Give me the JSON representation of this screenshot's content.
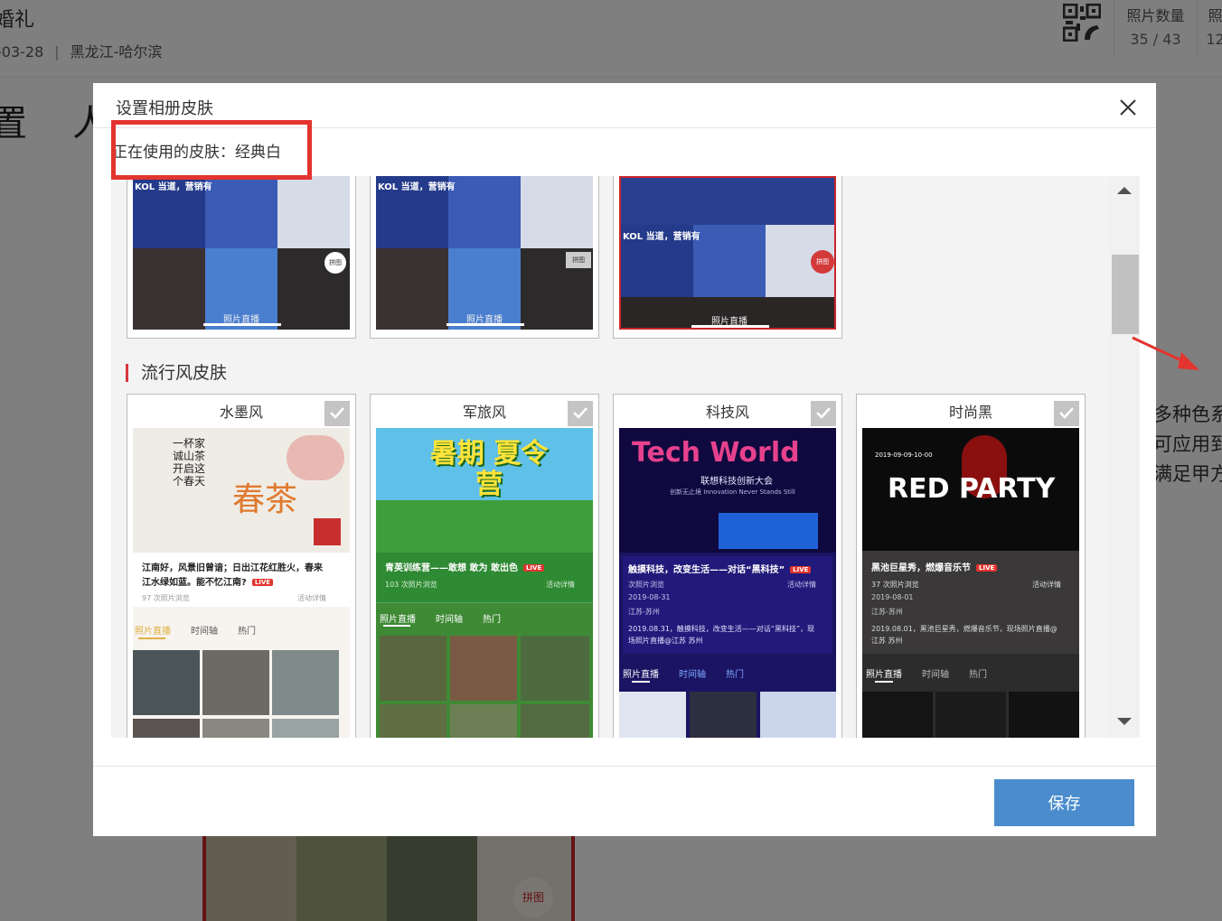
{
  "background": {
    "event_title": "婚礼",
    "event_date": "-03-28",
    "event_location": "黑龙江-哈尔滨",
    "stats": [
      {
        "label": "照片数量",
        "value": "35 / 43"
      },
      {
        "label": "照",
        "value": "12"
      }
    ],
    "left_glyphs": [
      "置",
      "人"
    ],
    "side_text": [
      "多种色系",
      "可应用到",
      "满足甲方"
    ],
    "bottom_poster_tag": "拼图"
  },
  "modal": {
    "title": "设置相册皮肤",
    "current_skin_label": "正在使用的皮肤：经典白",
    "save_label": "保存"
  },
  "classic_thumbs": [
    {
      "headline": "KOL 当道，营销有",
      "badge": "拼图",
      "footer": "照片直播"
    },
    {
      "headline": "KOL 当道，营销有",
      "badge": "拼图",
      "footer": "照片直播"
    },
    {
      "headline": "KOL 当道，营销有",
      "badge": "拼图",
      "footer": "照片直播"
    }
  ],
  "section": {
    "title": "流行风皮肤"
  },
  "skins": [
    {
      "name": "水墨风",
      "art_title": "春茶",
      "art_poem": "一杯家诚山茶开启这个春天",
      "event_line1": "江南好，风景旧曾谙；日出江花红胜火，春来",
      "event_line2": "江水绿如蓝。能不忆江南?",
      "badge": "LIVE",
      "views": "97 次照片浏览",
      "detail": "活动详情",
      "tabs": [
        "照片直播",
        "时间轴",
        "热门"
      ]
    },
    {
      "name": "军旅风",
      "art_title": "暑期 夏令营",
      "event_line1": "青英训练营——敢想 敢为 敢出色",
      "badge": "LIVE",
      "views": "103 次照片浏览",
      "detail": "活动详情",
      "tabs": [
        "照片直播",
        "时间轴",
        "热门"
      ]
    },
    {
      "name": "科技风",
      "art_title": "Tech World",
      "art_sub1": "联想科技创新大会",
      "art_sub2": "创新无止境 Innovation Never Stands Still",
      "event_line1": "触摸科技，改变生活——对话“黑科技”",
      "badge": "LIVE",
      "views": "次照片浏览",
      "detail": "活动详情",
      "date": "2019-08-31",
      "place": "江苏-苏州",
      "desc1": "2019.08.31，触摸科技，改变生活——对话“黑科技”，现",
      "desc2": "场照片直播@江苏 苏州",
      "tabs": [
        "照片直播",
        "时间轴",
        "热门"
      ]
    },
    {
      "name": "时尚黑",
      "art_title": "RED PARTY",
      "art_time": "2019-09-09-10-00",
      "event_line1": "黑池巨星秀，燃爆音乐节",
      "badge": "LIVE",
      "views": "37 次照片浏览",
      "detail": "活动详情",
      "date": "2019-08-01",
      "place": "江苏-苏州",
      "desc1": "2019.08.01，黑池巨星秀，燃爆音乐节，现场照片直播@",
      "desc2": "江苏 苏州",
      "tabs": [
        "照片直播",
        "时间轴",
        "热门"
      ]
    }
  ]
}
